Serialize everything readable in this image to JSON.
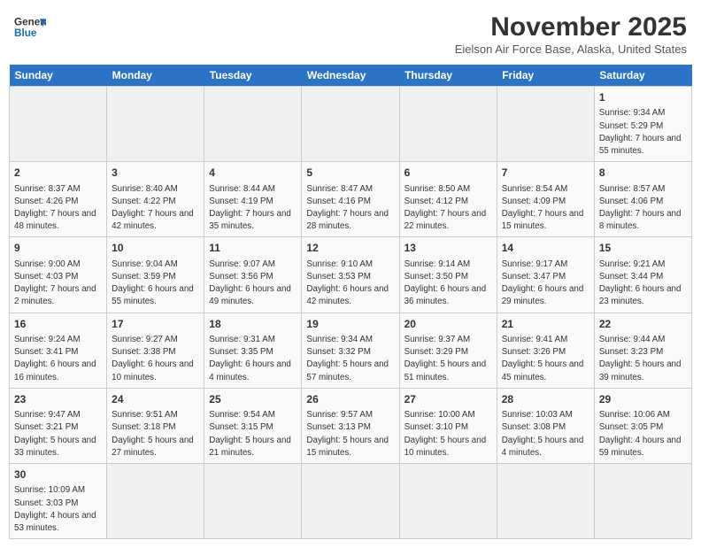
{
  "header": {
    "logo_line1": "General",
    "logo_line2": "Blue",
    "main_title": "November 2025",
    "subtitle": "Eielson Air Force Base, Alaska, United States"
  },
  "days_of_week": [
    "Sunday",
    "Monday",
    "Tuesday",
    "Wednesday",
    "Thursday",
    "Friday",
    "Saturday"
  ],
  "weeks": [
    [
      {
        "day": "",
        "info": ""
      },
      {
        "day": "",
        "info": ""
      },
      {
        "day": "",
        "info": ""
      },
      {
        "day": "",
        "info": ""
      },
      {
        "day": "",
        "info": ""
      },
      {
        "day": "",
        "info": ""
      },
      {
        "day": "1",
        "info": "Sunrise: 9:34 AM\nSunset: 5:29 PM\nDaylight: 7 hours and 55 minutes."
      }
    ],
    [
      {
        "day": "2",
        "info": "Sunrise: 8:37 AM\nSunset: 4:26 PM\nDaylight: 7 hours and 48 minutes."
      },
      {
        "day": "3",
        "info": "Sunrise: 8:40 AM\nSunset: 4:22 PM\nDaylight: 7 hours and 42 minutes."
      },
      {
        "day": "4",
        "info": "Sunrise: 8:44 AM\nSunset: 4:19 PM\nDaylight: 7 hours and 35 minutes."
      },
      {
        "day": "5",
        "info": "Sunrise: 8:47 AM\nSunset: 4:16 PM\nDaylight: 7 hours and 28 minutes."
      },
      {
        "day": "6",
        "info": "Sunrise: 8:50 AM\nSunset: 4:12 PM\nDaylight: 7 hours and 22 minutes."
      },
      {
        "day": "7",
        "info": "Sunrise: 8:54 AM\nSunset: 4:09 PM\nDaylight: 7 hours and 15 minutes."
      },
      {
        "day": "8",
        "info": "Sunrise: 8:57 AM\nSunset: 4:06 PM\nDaylight: 7 hours and 8 minutes."
      }
    ],
    [
      {
        "day": "9",
        "info": "Sunrise: 9:00 AM\nSunset: 4:03 PM\nDaylight: 7 hours and 2 minutes."
      },
      {
        "day": "10",
        "info": "Sunrise: 9:04 AM\nSunset: 3:59 PM\nDaylight: 6 hours and 55 minutes."
      },
      {
        "day": "11",
        "info": "Sunrise: 9:07 AM\nSunset: 3:56 PM\nDaylight: 6 hours and 49 minutes."
      },
      {
        "day": "12",
        "info": "Sunrise: 9:10 AM\nSunset: 3:53 PM\nDaylight: 6 hours and 42 minutes."
      },
      {
        "day": "13",
        "info": "Sunrise: 9:14 AM\nSunset: 3:50 PM\nDaylight: 6 hours and 36 minutes."
      },
      {
        "day": "14",
        "info": "Sunrise: 9:17 AM\nSunset: 3:47 PM\nDaylight: 6 hours and 29 minutes."
      },
      {
        "day": "15",
        "info": "Sunrise: 9:21 AM\nSunset: 3:44 PM\nDaylight: 6 hours and 23 minutes."
      }
    ],
    [
      {
        "day": "16",
        "info": "Sunrise: 9:24 AM\nSunset: 3:41 PM\nDaylight: 6 hours and 16 minutes."
      },
      {
        "day": "17",
        "info": "Sunrise: 9:27 AM\nSunset: 3:38 PM\nDaylight: 6 hours and 10 minutes."
      },
      {
        "day": "18",
        "info": "Sunrise: 9:31 AM\nSunset: 3:35 PM\nDaylight: 6 hours and 4 minutes."
      },
      {
        "day": "19",
        "info": "Sunrise: 9:34 AM\nSunset: 3:32 PM\nDaylight: 5 hours and 57 minutes."
      },
      {
        "day": "20",
        "info": "Sunrise: 9:37 AM\nSunset: 3:29 PM\nDaylight: 5 hours and 51 minutes."
      },
      {
        "day": "21",
        "info": "Sunrise: 9:41 AM\nSunset: 3:26 PM\nDaylight: 5 hours and 45 minutes."
      },
      {
        "day": "22",
        "info": "Sunrise: 9:44 AM\nSunset: 3:23 PM\nDaylight: 5 hours and 39 minutes."
      }
    ],
    [
      {
        "day": "23",
        "info": "Sunrise: 9:47 AM\nSunset: 3:21 PM\nDaylight: 5 hours and 33 minutes."
      },
      {
        "day": "24",
        "info": "Sunrise: 9:51 AM\nSunset: 3:18 PM\nDaylight: 5 hours and 27 minutes."
      },
      {
        "day": "25",
        "info": "Sunrise: 9:54 AM\nSunset: 3:15 PM\nDaylight: 5 hours and 21 minutes."
      },
      {
        "day": "26",
        "info": "Sunrise: 9:57 AM\nSunset: 3:13 PM\nDaylight: 5 hours and 15 minutes."
      },
      {
        "day": "27",
        "info": "Sunrise: 10:00 AM\nSunset: 3:10 PM\nDaylight: 5 hours and 10 minutes."
      },
      {
        "day": "28",
        "info": "Sunrise: 10:03 AM\nSunset: 3:08 PM\nDaylight: 5 hours and 4 minutes."
      },
      {
        "day": "29",
        "info": "Sunrise: 10:06 AM\nSunset: 3:05 PM\nDaylight: 4 hours and 59 minutes."
      }
    ],
    [
      {
        "day": "30",
        "info": "Sunrise: 10:09 AM\nSunset: 3:03 PM\nDaylight: 4 hours and 53 minutes."
      },
      {
        "day": "",
        "info": ""
      },
      {
        "day": "",
        "info": ""
      },
      {
        "day": "",
        "info": ""
      },
      {
        "day": "",
        "info": ""
      },
      {
        "day": "",
        "info": ""
      },
      {
        "day": "",
        "info": ""
      }
    ]
  ]
}
